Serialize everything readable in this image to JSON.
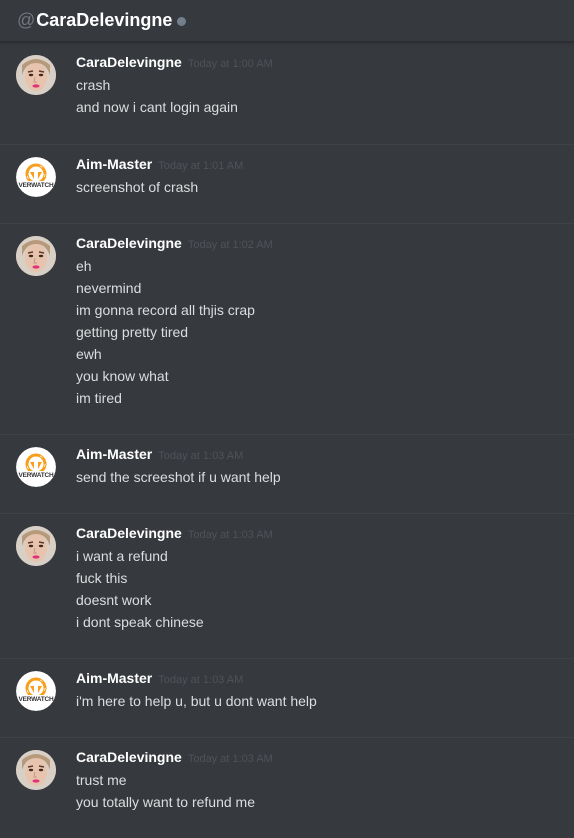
{
  "header": {
    "at_symbol": "@",
    "channel_name": "CaraDelevingne"
  },
  "users": {
    "cara": "CaraDelevingne",
    "aim": "Aim-Master"
  },
  "messages": [
    {
      "author": "CaraDelevingne",
      "avatar": "portrait-avatar",
      "timestamp": "Today at 1:00 AM",
      "lines": [
        "crash",
        "and now i cant login again"
      ]
    },
    {
      "author": "Aim-Master",
      "avatar": "overwatch-logo-avatar",
      "timestamp": "Today at 1:01 AM",
      "lines": [
        "screenshot of crash"
      ]
    },
    {
      "author": "CaraDelevingne",
      "avatar": "portrait-avatar",
      "timestamp": "Today at 1:02 AM",
      "lines": [
        "eh",
        "nevermind",
        "im gonna record all thjis crap",
        "getting pretty tired",
        "ewh",
        "you know what",
        "im tired"
      ]
    },
    {
      "author": "Aim-Master",
      "avatar": "overwatch-logo-avatar",
      "timestamp": "Today at 1:03 AM",
      "lines": [
        "send the screeshot if u want help"
      ]
    },
    {
      "author": "CaraDelevingne",
      "avatar": "portrait-avatar",
      "timestamp": "Today at 1:03 AM",
      "lines": [
        "i want a refund",
        "fuck this",
        "doesnt work",
        "i dont speak chinese"
      ]
    },
    {
      "author": "Aim-Master",
      "avatar": "overwatch-logo-avatar",
      "timestamp": "Today at 1:03 AM",
      "lines": [
        "i'm here to help u, but u dont want help"
      ]
    },
    {
      "author": "CaraDelevingne",
      "avatar": "portrait-avatar",
      "timestamp": "Today at 1:03 AM",
      "lines": [
        "trust me",
        "you totally want to refund me"
      ]
    }
  ],
  "logo_text": "VERWATCH",
  "colors": {
    "background": "#36393e",
    "username": "#ffffff",
    "text": "#dcddde",
    "timestamp": "#4f5358",
    "status_offline": "#747f8d",
    "overwatch_orange": "#f99e1a"
  }
}
